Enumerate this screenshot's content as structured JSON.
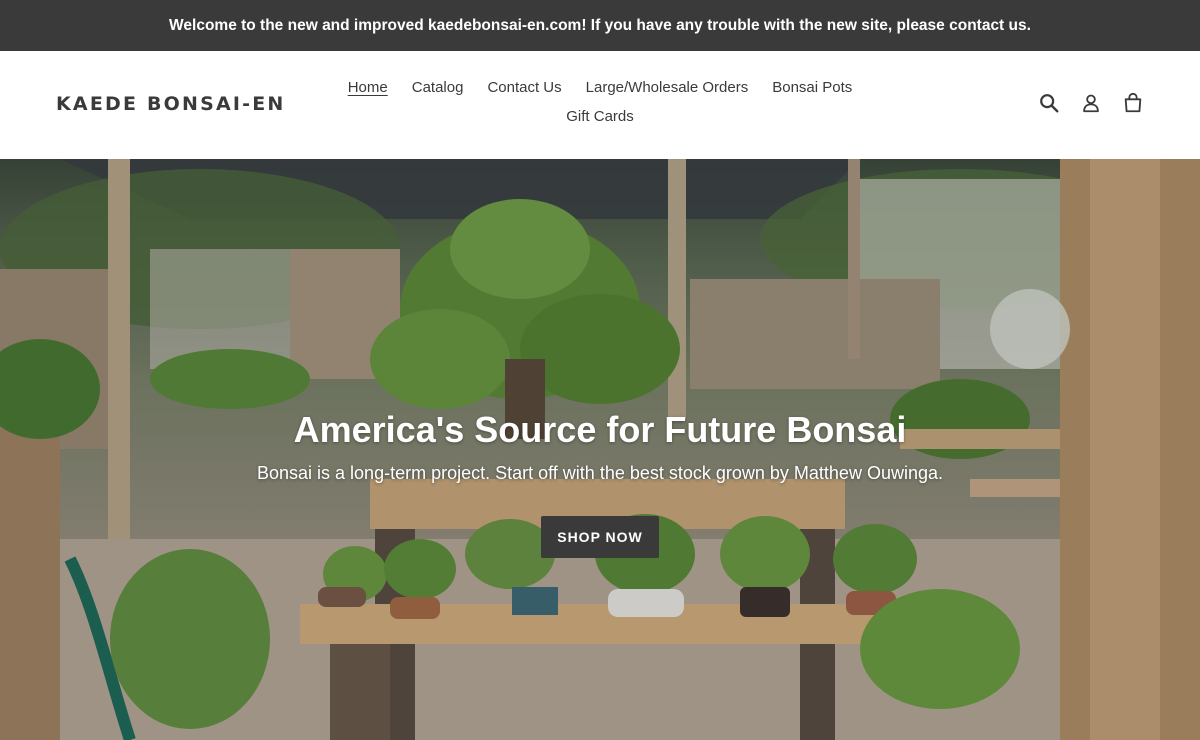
{
  "announcement": {
    "text": "Welcome to the new and improved kaedebonsai-en.com! If you have any trouble with the new site, please contact us."
  },
  "header": {
    "logo": "KAEDE BONSAI-EN",
    "nav": [
      {
        "label": "Home",
        "active": true
      },
      {
        "label": "Catalog",
        "active": false
      },
      {
        "label": "Contact Us",
        "active": false
      },
      {
        "label": "Large/Wholesale Orders",
        "active": false
      },
      {
        "label": "Bonsai Pots",
        "active": false
      },
      {
        "label": "Gift Cards",
        "active": false
      }
    ],
    "icons": [
      "search-icon",
      "account-icon",
      "cart-icon"
    ]
  },
  "hero": {
    "title": "America's Source for Future Bonsai",
    "subtitle": "Bonsai is a long-term project. Start off with the best stock grown by Matthew Ouwinga.",
    "button_label": "SHOP NOW"
  },
  "colors": {
    "announcement_bg": "#3a3a3a",
    "text": "#3a3a3a",
    "button_bg": "#3a3a3a"
  }
}
